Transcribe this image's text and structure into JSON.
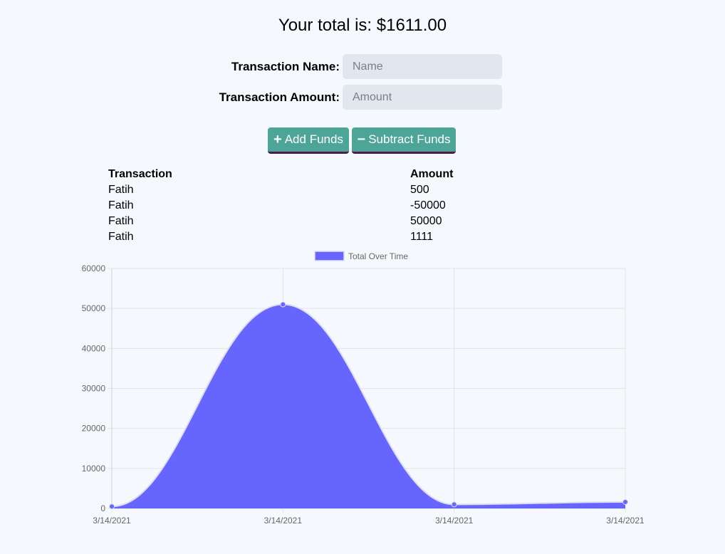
{
  "header": {
    "total_text": "Your total is: $1611.00"
  },
  "form": {
    "name_label": "Transaction Name:",
    "name_placeholder": "Name",
    "amount_label": "Transaction Amount:",
    "amount_placeholder": "Amount"
  },
  "buttons": {
    "add_label": "Add Funds",
    "subtract_label": "Subtract Funds"
  },
  "table": {
    "headers": [
      "Transaction",
      "Amount"
    ],
    "rows": [
      [
        "Fatih",
        "500"
      ],
      [
        "Fatih",
        "-50000"
      ],
      [
        "Fatih",
        "50000"
      ],
      [
        "Fatih",
        "1111"
      ]
    ]
  },
  "chart_data": {
    "type": "area",
    "series": [
      {
        "name": "Total Over Time",
        "color": "#6666ff",
        "values": [
          500,
          51000,
          1000,
          1611
        ]
      }
    ],
    "categories": [
      "3/14/2021",
      "3/14/2021",
      "3/14/2021",
      "3/14/2021"
    ],
    "yticks": [
      "0",
      "10000",
      "20000",
      "30000",
      "40000",
      "50000",
      "60000"
    ],
    "ylim": [
      0,
      60000
    ],
    "grid": true,
    "legend": "top"
  }
}
